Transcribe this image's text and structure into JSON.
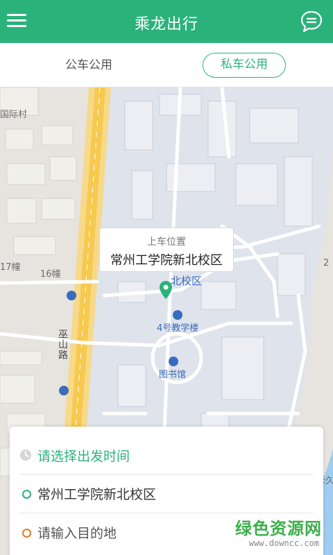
{
  "header": {
    "title": "乘龙出行",
    "menu_icon": "menu-icon",
    "chat_icon": "chat-icon",
    "color": "#2bb27b"
  },
  "tabs": [
    {
      "label": "公车公用",
      "selected": false
    },
    {
      "label": "私车公用",
      "selected": true
    }
  ],
  "map": {
    "labels": {
      "village": "国际村",
      "bldg17": "17幢",
      "bldg16": "16幢",
      "road": "巫山路",
      "right_num": "2",
      "campus": "北校区",
      "teach4": "4号教学楼",
      "library": "图书馆",
      "right_edge": "禾久"
    },
    "callout": {
      "subtitle": "上车位置",
      "title": "常州工学院新北校区"
    }
  },
  "card": {
    "time_label": "请选择出发时间",
    "origin": "常州工学院新北校区",
    "destination_placeholder": "请输入目的地"
  },
  "watermark": {
    "name": "绿色资源网",
    "url": "www.downcc.com"
  }
}
